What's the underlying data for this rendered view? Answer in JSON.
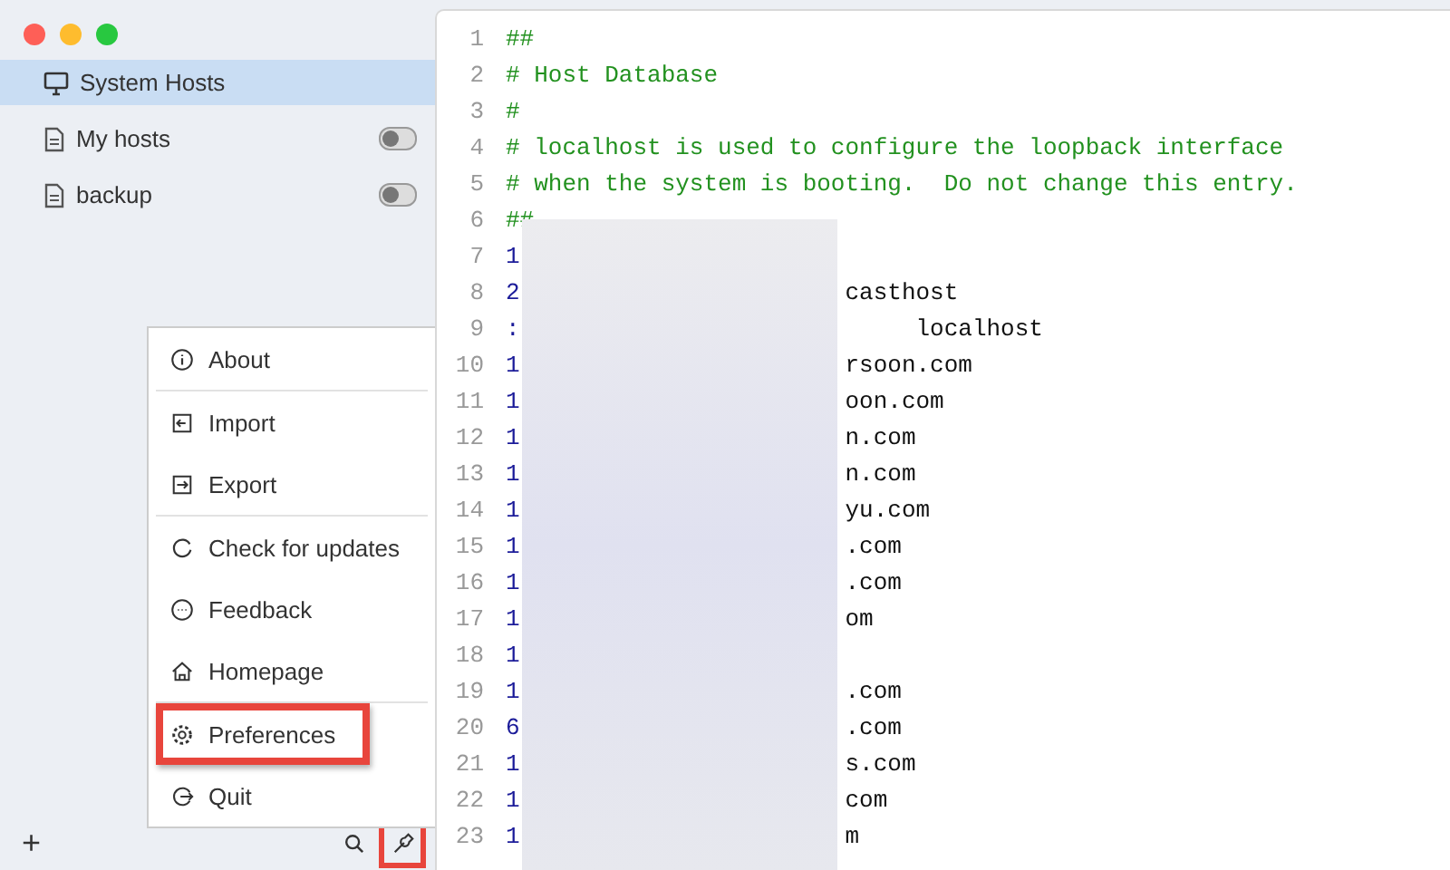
{
  "sidebar": {
    "items": [
      {
        "label": "System Hosts",
        "kind": "system",
        "selected": true
      },
      {
        "label": "My hosts",
        "kind": "file",
        "selected": false,
        "on": false
      },
      {
        "label": "backup",
        "kind": "file",
        "selected": false,
        "on": false
      }
    ]
  },
  "menu": {
    "groups": [
      [
        {
          "label": "About",
          "highlighted": false
        }
      ],
      [
        {
          "label": "Import",
          "highlighted": false
        },
        {
          "label": "Export",
          "highlighted": false
        }
      ],
      [
        {
          "label": "Check for updates",
          "highlighted": false
        },
        {
          "label": "Feedback",
          "highlighted": false
        },
        {
          "label": "Homepage",
          "highlighted": false
        }
      ],
      [
        {
          "label": "Preferences",
          "highlighted": true
        },
        {
          "label": "Quit",
          "highlighted": false
        }
      ]
    ]
  },
  "bottom_bar": {
    "add": "+",
    "tools_highlighted": true
  },
  "editor": {
    "lines": [
      {
        "n": "1",
        "kind": "comment",
        "text": "##"
      },
      {
        "n": "2",
        "kind": "comment",
        "text": "# Host Database"
      },
      {
        "n": "3",
        "kind": "comment",
        "text": "#"
      },
      {
        "n": "4",
        "kind": "comment",
        "text": "# localhost is used to configure the loopback interface"
      },
      {
        "n": "5",
        "kind": "comment",
        "text": "# when the system is booting.  Do not change this entry."
      },
      {
        "n": "6",
        "kind": "comment",
        "text": "##"
      },
      {
        "n": "7",
        "kind": "entry",
        "lead": "1"
      },
      {
        "n": "8",
        "kind": "entry",
        "lead": "2",
        "tail": "casthost"
      },
      {
        "n": "9",
        "kind": "entry",
        "lead": ":",
        "tail": "     localhost"
      },
      {
        "n": "10",
        "kind": "entry",
        "lead": "1",
        "tail": "rsoon.com"
      },
      {
        "n": "11",
        "kind": "entry",
        "lead": "1",
        "tail": "oon.com"
      },
      {
        "n": "12",
        "kind": "entry",
        "lead": "1",
        "tail": "n.com"
      },
      {
        "n": "13",
        "kind": "entry",
        "lead": "1",
        "tail": "n.com"
      },
      {
        "n": "14",
        "kind": "entry",
        "lead": "1",
        "tail": "yu.com"
      },
      {
        "n": "15",
        "kind": "entry",
        "lead": "1",
        "tail": ".com"
      },
      {
        "n": "16",
        "kind": "entry",
        "lead": "1",
        "tail": ".com"
      },
      {
        "n": "17",
        "kind": "entry",
        "lead": "1",
        "tail": "om"
      },
      {
        "n": "18",
        "kind": "entry",
        "lead": "1"
      },
      {
        "n": "19",
        "kind": "entry",
        "lead": "1",
        "tail": ".com"
      },
      {
        "n": "20",
        "kind": "entry",
        "lead": "6",
        "tail": ".com"
      },
      {
        "n": "21",
        "kind": "entry",
        "lead": "1",
        "tail": "s.com"
      },
      {
        "n": "22",
        "kind": "entry",
        "lead": "1",
        "tail": "com"
      },
      {
        "n": "23",
        "kind": "entry",
        "lead": "1",
        "tail": "m"
      }
    ]
  }
}
